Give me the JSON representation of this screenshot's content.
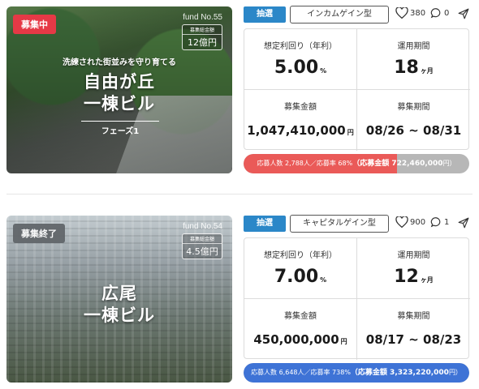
{
  "colors": {
    "open": "#e63946",
    "closed": "#5f6468",
    "lottery": "#2b87c8",
    "progress_open": "#ea5a58",
    "progress_full": "#3e73d6",
    "progress_track": "#b7b7b7"
  },
  "funds": [
    {
      "status": "募集中",
      "fund_no": "fund No.55",
      "total_label": "募集総金額",
      "total_value": "12億円",
      "tagline": "洗練された街並みを守り育てる",
      "name_line1": "自由が丘",
      "name_line2": "一棟ビル",
      "phase": "フェーズ1",
      "method": "抽選",
      "gain_type": "インカムゲイン型",
      "likes": "380",
      "comments": "0",
      "yield_label": "想定利回り（年利）",
      "yield_value": "5.00",
      "yield_unit": "%",
      "period_label": "運用期間",
      "period_value": "18",
      "period_unit": "ヶ月",
      "amount_label": "募集金額",
      "amount_value": "1,047,410,000",
      "amount_unit": "円",
      "recruit_label": "募集期間",
      "recruit_value": "08/26 ~ 08/31",
      "progress_text": "応募人数 2,788人／応募率 68%",
      "progress_amount": "（応募金額 722,460,000",
      "progress_unit": "円）",
      "progress_percent": 68
    },
    {
      "status": "募集終了",
      "fund_no": "fund No.54",
      "total_label": "募集総金額",
      "total_value": "4.5億円",
      "tagline": "",
      "name_line1": "広尾",
      "name_line2": "一棟ビル",
      "phase": "",
      "method": "抽選",
      "gain_type": "キャピタルゲイン型",
      "likes": "900",
      "comments": "1",
      "yield_label": "想定利回り（年利）",
      "yield_value": "7.00",
      "yield_unit": "%",
      "period_label": "運用期間",
      "period_value": "12",
      "period_unit": "ヶ月",
      "amount_label": "募集金額",
      "amount_value": "450,000,000",
      "amount_unit": "円",
      "recruit_label": "募集期間",
      "recruit_value": "08/17 ~ 08/23",
      "progress_text": "応募人数 6,648人／応募率 738%",
      "progress_amount": "（応募金額 3,323,220,000",
      "progress_unit": "円）",
      "progress_percent": 738
    }
  ]
}
